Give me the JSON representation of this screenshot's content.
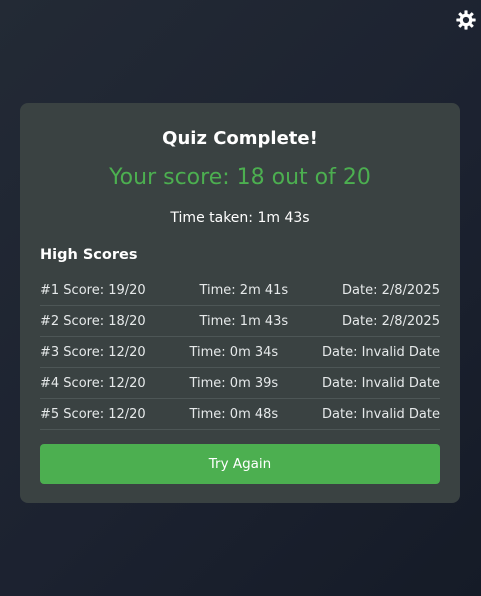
{
  "settings": {
    "icon": "gear-icon"
  },
  "result": {
    "title": "Quiz Complete!",
    "score_text": "Your score: 18 out of 20",
    "time_text": "Time taken: 1m 43s"
  },
  "high_scores": {
    "heading": "High Scores",
    "rows": [
      {
        "score": "#1 Score: 19/20",
        "time": "Time: 2m 41s",
        "date": "Date: 2/8/2025"
      },
      {
        "score": "#2 Score: 18/20",
        "time": "Time: 1m 43s",
        "date": "Date: 2/8/2025"
      },
      {
        "score": "#3 Score: 12/20",
        "time": "Time: 0m 34s",
        "date": "Date: Invalid Date"
      },
      {
        "score": "#4 Score: 12/20",
        "time": "Time: 0m 39s",
        "date": "Date: Invalid Date"
      },
      {
        "score": "#5 Score: 12/20",
        "time": "Time: 0m 48s",
        "date": "Date: Invalid Date"
      }
    ]
  },
  "actions": {
    "try_again_label": "Try Again"
  },
  "colors": {
    "accent_green": "#4caf50",
    "card_background": "#3a4242",
    "page_background": "#1c2230",
    "divider": "#4d5656"
  }
}
